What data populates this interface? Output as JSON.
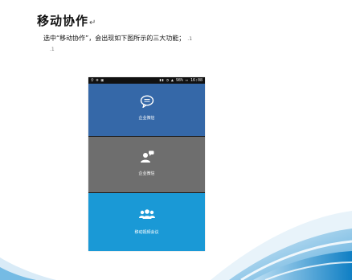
{
  "document": {
    "heading": "移动协作",
    "heading_mark": "↵",
    "description": "选中“移动协作”，会出现如下图所示的三大功能；",
    "description_mark": ".1",
    "paragraph_mark": ".1"
  },
  "phone": {
    "status_left": "⚲ ⚙ ▣",
    "status_right": "▮▮ ◔ ▲ 98% ▭ 16:08",
    "items": [
      {
        "label": "企业微信",
        "icon": "chat-bubble-icon",
        "color": "#3568a8"
      },
      {
        "label": "企业微信",
        "icon": "user-chat-icon",
        "color": "#6e6e6e"
      },
      {
        "label": "移动视频会议",
        "icon": "group-users-icon",
        "color": "#1a99d6"
      }
    ]
  },
  "colors": {
    "wave_blue": "#1f8fd0",
    "wave_light": "#a9d5ef"
  }
}
